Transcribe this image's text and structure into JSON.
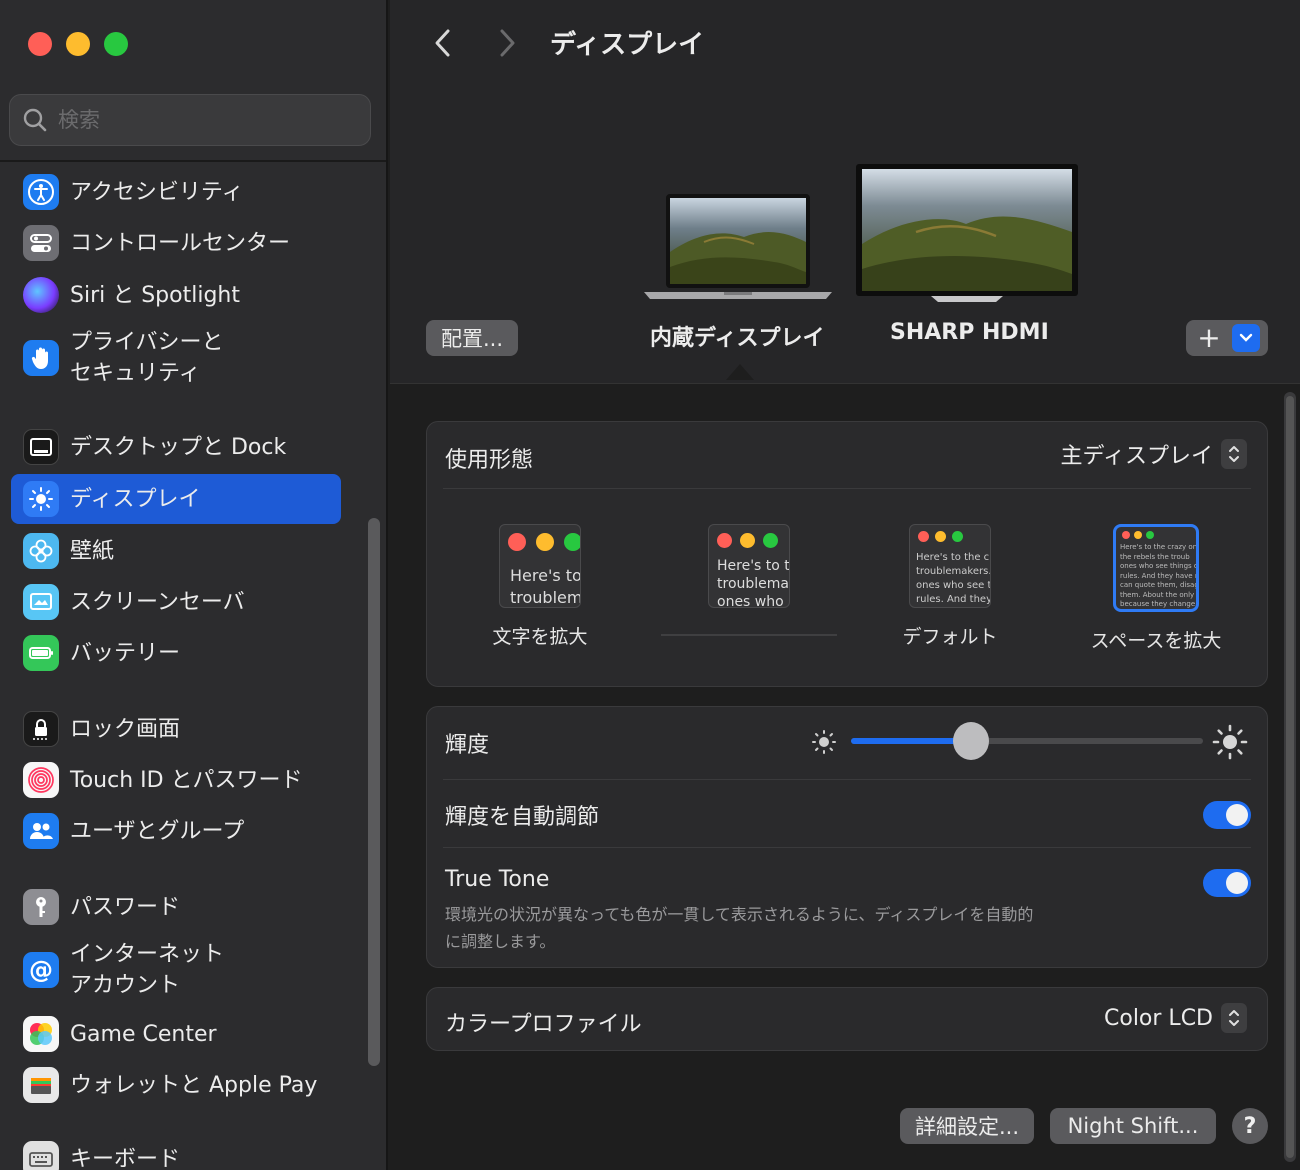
{
  "sidebar": {
    "search_placeholder": "検索",
    "items": [
      {
        "label": "アクセシビリティ",
        "icon": "accessibility-icon"
      },
      {
        "label": "コントロールセンター",
        "icon": "control-center-icon"
      },
      {
        "label": "Siri と Spotlight",
        "icon": "siri-icon"
      },
      {
        "label": "プライバシーと",
        "label2": "セキュリティ",
        "icon": "privacy-hand-icon"
      },
      {
        "label": "デスクトップと Dock",
        "icon": "desktop-dock-icon"
      },
      {
        "label": "ディスプレイ",
        "icon": "display-brightness-icon",
        "selected": true
      },
      {
        "label": "壁紙",
        "icon": "wallpaper-flower-icon"
      },
      {
        "label": "スクリーンセーバ",
        "icon": "screensaver-icon"
      },
      {
        "label": "バッテリー",
        "icon": "battery-icon"
      },
      {
        "label": "ロック画面",
        "icon": "lock-screen-icon"
      },
      {
        "label": "Touch ID とパスワード",
        "icon": "fingerprint-icon"
      },
      {
        "label": "ユーザとグループ",
        "icon": "users-icon"
      },
      {
        "label": "パスワード",
        "icon": "key-icon"
      },
      {
        "label": "インターネット",
        "label2": "アカウント",
        "icon": "at-sign-icon"
      },
      {
        "label": "Game Center",
        "icon": "game-center-icon"
      },
      {
        "label": "ウォレットと Apple Pay",
        "icon": "wallet-icon"
      },
      {
        "label": "キーボード",
        "icon": "keyboard-icon"
      }
    ]
  },
  "header": {
    "title": "ディスプレイ"
  },
  "displays": {
    "arrange_label": "配置...",
    "builtin_label": "内蔵ディスプレイ",
    "external_label": "SHARP HDMI",
    "add_label": "+"
  },
  "usage": {
    "label": "使用形態",
    "value": "主ディスプレイ",
    "modes": [
      {
        "label": "文字を拡大",
        "preview": [
          "Here's to",
          "troublem"
        ]
      },
      {
        "label": "",
        "preview": [
          "Here's to t",
          "troublema",
          "ones who"
        ]
      },
      {
        "label": "デフォルト",
        "preview": [
          "Here's to the cr",
          "troublemakers.",
          "ones who see t",
          "rules. And they"
        ]
      },
      {
        "label": "スペースを拡大",
        "preview": [
          "Here's to the crazy one",
          "the rebels the troub",
          "ones who see things dif",
          "rules. And they have no",
          "can quote them, disagr",
          "them. About the only th",
          "because they change t"
        ],
        "selected": true
      }
    ]
  },
  "brightness": {
    "label": "輝度",
    "level": 0.34,
    "auto_label": "輝度を自動調節",
    "auto_on": true,
    "true_tone_label": "True Tone",
    "true_tone_on": true,
    "true_tone_desc_1": "環境光の状況が異なっても色が一貫して表示されるように、ディスプレイを自動的",
    "true_tone_desc_2": "に調整します。"
  },
  "color_profile": {
    "label": "カラープロファイル",
    "value": "Color LCD"
  },
  "footer": {
    "advanced_label": "詳細設定...",
    "night_shift_label": "Night Shift...",
    "help_label": "?"
  },
  "colors": {
    "accent": "#1e6cf0",
    "selection": "#1e5bd6",
    "background": "#1e1e1e"
  }
}
